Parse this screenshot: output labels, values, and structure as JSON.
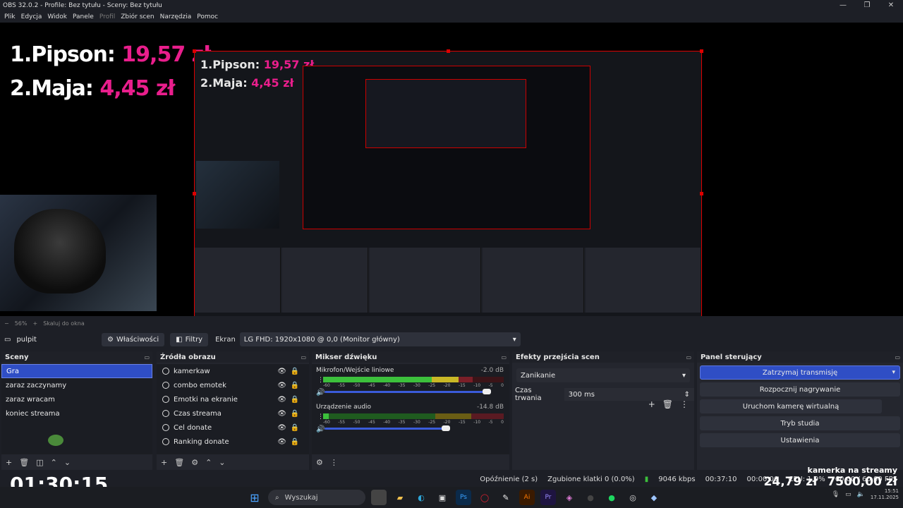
{
  "window": {
    "title": "OBS 32.0.2 - Profile: Bez tytułu - Sceny: Bez tytułu",
    "controls": [
      "—",
      "❐",
      "✕"
    ]
  },
  "menu": [
    "Plik",
    "Edycja",
    "Widok",
    "Panele",
    "Profil",
    "Zbiór scen",
    "Narzędzia",
    "Pomoc"
  ],
  "overlay": {
    "rank1_name": "1.Pipson:",
    "rank1_amount": "19,57 zł",
    "rank2_name": "2.Maja:",
    "rank2_amount": "4,45 zł",
    "timer": "01:30:15",
    "cam_label": "kamerka na streamy",
    "total1": "24,79 zł",
    "total2": "7500,00 zł"
  },
  "preview_strip": {
    "zoom": "56%",
    "fit": "Skaluj do okna"
  },
  "source_toolbar": {
    "source_name": "pulpit",
    "properties_label": "Właściwości",
    "filters_label": "Filtry",
    "screen_label": "Ekran",
    "screen_value": "LG FHD: 1920x1080 @ 0,0 (Monitor główny)"
  },
  "scenes": {
    "title": "Sceny",
    "items": [
      "Gra",
      "zaraz zaczynamy",
      "zaraz wracam",
      "koniec streama"
    ],
    "active_index": 0
  },
  "sources": {
    "title": "Źródła obrazu",
    "items": [
      "kamerkaw",
      "combo emotek",
      "Emotki na ekranie",
      "Czas streama",
      "Cel donate",
      "Ranking donate"
    ]
  },
  "mixer": {
    "title": "Mikser dźwięku",
    "tracks": [
      {
        "name": "Mikrofon/Wejście liniowe",
        "db": "-2.0 dB",
        "level": 0.82,
        "volume": 0.95
      },
      {
        "name": "Urządzenie audio",
        "db": "-14.8 dB",
        "level": 0.62,
        "volume": 0.66
      }
    ],
    "ticks": [
      "-60",
      "-55",
      "-50",
      "-45",
      "-40",
      "-35",
      "-30",
      "-25",
      "-20",
      "-15",
      "-10",
      "-5",
      "0"
    ]
  },
  "transitions": {
    "title": "Efekty przejścia scen",
    "selected": "Zanikanie",
    "duration_label": "Czas trwania",
    "duration_value": "300 ms"
  },
  "controls": {
    "title": "Panel sterujący",
    "stop_stream": "Zatrzymaj transmisję",
    "start_recording": "Rozpocznij nagrywanie",
    "virtual_cam": "Uruchom kamerę wirtualną",
    "studio_mode": "Tryb studia",
    "settings": "Ustawienia"
  },
  "statusbar": {
    "delay": "Opóźnienie (2 s)",
    "dropped": "Zgubione klatki 0 (0.0%)",
    "bitrate": "9046 kbps",
    "time": "00:37:10",
    "rec_time": "00:00:00",
    "cpu": "CPU: 1,9%",
    "fps": "60,00 / 60,00 FPS"
  },
  "taskbar": {
    "search_placeholder": "Wyszukaj",
    "clock_time": "15:51",
    "clock_date": "17.11.2025"
  },
  "colors": {
    "accent": "#2f4ec5",
    "money": "#e91e8c",
    "selection_border": "#dd0000"
  }
}
